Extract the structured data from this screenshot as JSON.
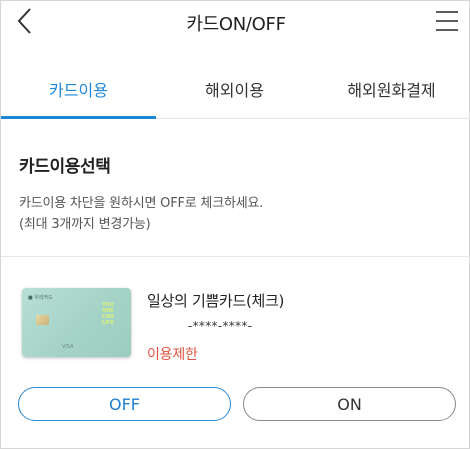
{
  "header": {
    "title": "카드ON/OFF",
    "back_icon": "chevron-left-icon",
    "menu_icon": "hamburger-menu-icon"
  },
  "tabs": [
    {
      "label": "카드이용",
      "active": true
    },
    {
      "label": "해외이용",
      "active": false
    },
    {
      "label": "해외원화결제",
      "active": false
    }
  ],
  "section": {
    "title": "카드이용선택",
    "description_line1": "카드이용 차단을 원하시면 OFF로 체크하세요.",
    "description_line2": "(최대 3개까지 변경가능)"
  },
  "card": {
    "name": "일상의 기쁨카드(체크)",
    "number": "-****-****-",
    "status": "이용제한",
    "image_bank_text": "■ 우리카드",
    "image_logo_text": "YOU ONE LIKE LIFE",
    "image_brand_text": "VISA"
  },
  "buttons": {
    "off_label": "OFF",
    "on_label": "ON"
  },
  "colors": {
    "accent": "#1e88d8",
    "status_restricted": "#e0533f",
    "card_face": "#a6d3c7"
  }
}
